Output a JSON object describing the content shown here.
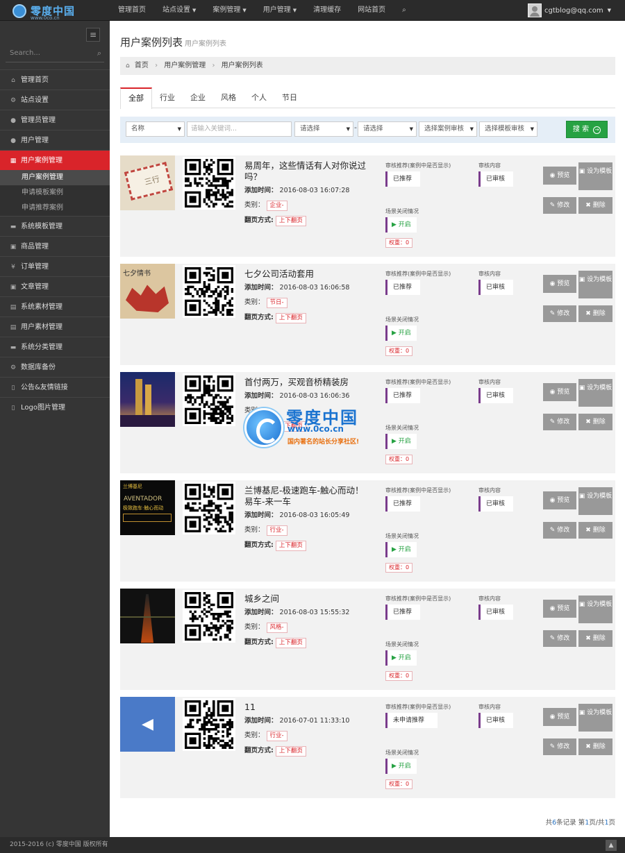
{
  "header": {
    "logo_text": "零度中国",
    "logo_sub": "www.0co.cn",
    "nav": [
      {
        "label": "管理首页",
        "has_caret": false
      },
      {
        "label": "站点设置",
        "has_caret": true
      },
      {
        "label": "案例管理",
        "has_caret": true
      },
      {
        "label": "用户管理",
        "has_caret": true
      },
      {
        "label": "清理缓存",
        "has_caret": false
      },
      {
        "label": "网站首页",
        "has_caret": false
      }
    ],
    "user_email": "cgtblog@qq.com"
  },
  "sidebar": {
    "search_placeholder": "Search...",
    "items": [
      {
        "label": "管理首页",
        "icon": "home-icon",
        "glyph": "⌂"
      },
      {
        "label": "站点设置",
        "icon": "cogs-icon",
        "glyph": "⚙"
      },
      {
        "label": "管理员管理",
        "icon": "user-icon",
        "glyph": "●"
      },
      {
        "label": "用户管理",
        "icon": "user-icon",
        "glyph": "●"
      },
      {
        "label": "用户案例管理",
        "icon": "table-icon",
        "glyph": "▦",
        "active": true
      },
      {
        "label": "系统模板管理",
        "icon": "briefcase-icon",
        "glyph": "▬"
      },
      {
        "label": "商品管理",
        "icon": "box-icon",
        "glyph": "▣"
      },
      {
        "label": "订单管理",
        "icon": "yen-icon",
        "glyph": "¥"
      },
      {
        "label": "文章管理",
        "icon": "box-icon",
        "glyph": "▣"
      },
      {
        "label": "系统素材管理",
        "icon": "gift-icon",
        "glyph": "▤"
      },
      {
        "label": "用户素材管理",
        "icon": "gift-icon",
        "glyph": "▤"
      },
      {
        "label": "系统分类管理",
        "icon": "briefcase-icon",
        "glyph": "▬"
      },
      {
        "label": "数据库备份",
        "icon": "cogs-icon",
        "glyph": "⚙"
      },
      {
        "label": "公告&友情链接",
        "icon": "bookmark-icon",
        "glyph": "▯"
      },
      {
        "label": "Logo图片管理",
        "icon": "bookmark-icon",
        "glyph": "▯"
      }
    ],
    "submenu": [
      {
        "label": "用户案例管理",
        "active": true
      },
      {
        "label": "申请模板案例",
        "active": false
      },
      {
        "label": "申请推荐案例",
        "active": false
      }
    ]
  },
  "page": {
    "title": "用户案例列表",
    "subtitle": "用户案例列表",
    "breadcrumb": [
      "首页",
      "用户案例管理",
      "用户案例列表"
    ]
  },
  "tabs": [
    {
      "label": "全部",
      "active": true
    },
    {
      "label": "行业",
      "active": false
    },
    {
      "label": "企业",
      "active": false
    },
    {
      "label": "风格",
      "active": false
    },
    {
      "label": "个人",
      "active": false
    },
    {
      "label": "节日",
      "active": false
    }
  ],
  "filter": {
    "field_select": "名称",
    "keyword_placeholder": "请输入关键词...",
    "select_a": "请选择",
    "dash": "-",
    "select_b": "请选择",
    "case_review": "选择案例审核",
    "tpl_review": "选择模板审核",
    "search_label": "搜 索"
  },
  "labels": {
    "add_time": "添加时间：",
    "category": "类别：",
    "flip": "翻页方式:",
    "recommend_header": "审核推荐(案例中是否显示)",
    "review_header": "审核内容",
    "scene_header": "场景关闭情况",
    "open": "开启",
    "preview": "预览",
    "set_template": "设为模板",
    "edit": "修改",
    "delete": "删除"
  },
  "cases": [
    {
      "title": "易周年，这些情话有人对你说过吗？",
      "time": "2016-08-03 16:07:28",
      "category": "企业-",
      "flip": "上下翻页",
      "recommend": "已推荐",
      "review": "已审核",
      "weight": "权重：0",
      "thumb": "envelope"
    },
    {
      "title": "七夕公司活动套用",
      "time": "2016-08-03 16:06:58",
      "category": "节日-",
      "flip": "上下翻页",
      "recommend": "已推荐",
      "review": "已审核",
      "weight": "权重：0",
      "thumb": "qixi"
    },
    {
      "title": "首付两万，买观音桥精装房",
      "time": "2016-08-03 16:06:36",
      "category": "",
      "flip": "上下翻页",
      "recommend": "已推荐",
      "review": "已审核",
      "weight": "权重：0",
      "thumb": "city"
    },
    {
      "title": "兰博基尼-极速跑车-触心而动！易车-来一车",
      "time": "2016-08-03 16:05:49",
      "category": "行业-",
      "flip": "上下翻页",
      "recommend": "已推荐",
      "review": "已审核",
      "weight": "权重：0",
      "thumb": "car"
    },
    {
      "title": "城乡之间",
      "time": "2016-08-03 15:55:32",
      "category": "风格-",
      "flip": "上下翻页",
      "recommend": "已推荐",
      "review": "已审核",
      "weight": "权重：0",
      "thumb": "bridge"
    },
    {
      "title": "11",
      "time": "2016-07-01 11:33:10",
      "category": "行业-",
      "flip": "上下翻页",
      "recommend": "未申请推荐",
      "review": "已审核",
      "weight": "权重：0",
      "thumb": "megaphone"
    }
  ],
  "thumb_texts": {
    "envelope": "三行",
    "qixi": "七夕情书",
    "car_brand": "兰博基尼",
    "car_model": "AVENTADOR",
    "car_slogan": "极致跑车·触心而动"
  },
  "pager": {
    "prefix": "共",
    "count": "6",
    "mid": "条记录 第",
    "page": "1",
    "sep": "页/共",
    "total": "1",
    "suffix": "页"
  },
  "watermark": {
    "title": "零度中国",
    "url": "www.0co.cn",
    "slogan": "国内著名的站长分享社区!"
  },
  "footer": {
    "copyright": "2015-2016 (c) 零度中国 版权所有"
  },
  "colors": {
    "accent": "#d9242a",
    "green": "#27a243",
    "purple": "#7a3c8c",
    "sidebar": "#353535",
    "topbar": "#2b2b2b"
  }
}
